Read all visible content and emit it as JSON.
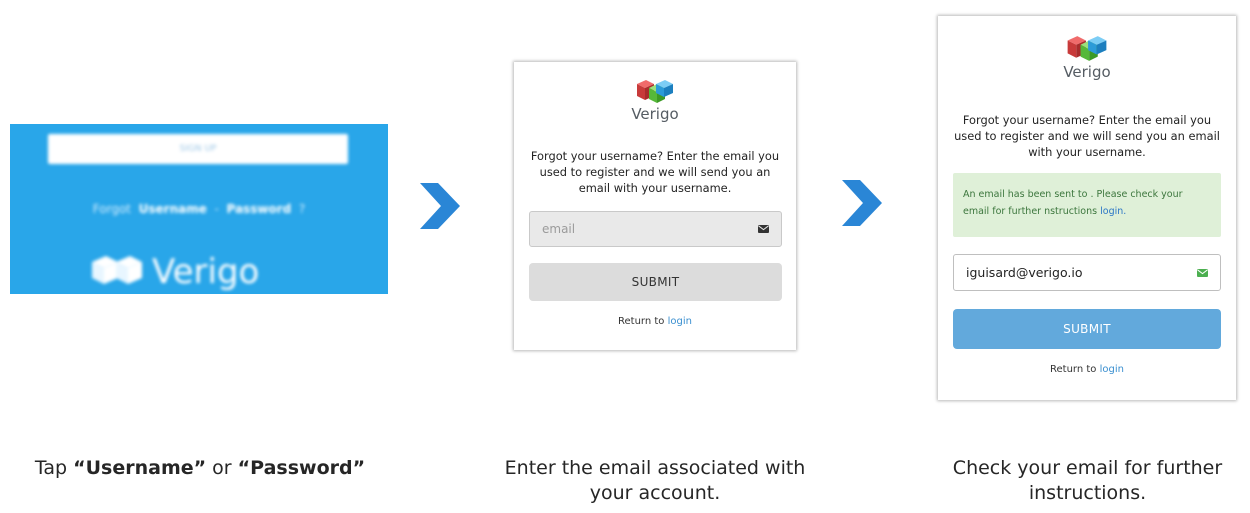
{
  "step1": {
    "signin_label": "SIGN UP",
    "forgot_prefix": "Forgot",
    "username_link": "Username",
    "separator": "-",
    "password_link": "Password",
    "question": "?",
    "logo_text": "Verigo",
    "background_color": "#29a6e9"
  },
  "step2": {
    "logo_text": "Verigo",
    "description": "Forgot your username? Enter the email you used to register and we will send you an email with your username.",
    "email_placeholder": "email",
    "email_value": "",
    "submit_label": "SUBMIT",
    "return_prefix": "Return to",
    "return_link": "login"
  },
  "step3": {
    "logo_text": "Verigo",
    "description": "Forgot your username? Enter the email you used to register and we will send you an email with your username.",
    "alert_text": "An email has been sent to . Please check your email for further nstructions",
    "alert_link": "login.",
    "email_value": "iguisard@verigo.io",
    "submit_label": "SUBMIT",
    "return_prefix": "Return to",
    "return_link": "login",
    "alert_color": "#dff0d8",
    "submit_color": "#62a9dc"
  },
  "captions": {
    "step1_prefix": "Tap ",
    "step1_q1": "“",
    "step1_username": "Username",
    "step1_q2": "”",
    "step1_or": " or ",
    "step1_q3": "“",
    "step1_password": "Password",
    "step1_q4": "”",
    "step2": "Enter the email associated with your account.",
    "step3": "Check your email for further instructions."
  },
  "colors": {
    "arrow": "#2a86d6",
    "link": "#3a8fd0"
  },
  "icons": {
    "arrow": "chevron-right-icon",
    "mail": "envelope-icon",
    "logo": "verigo-cube-logo"
  }
}
